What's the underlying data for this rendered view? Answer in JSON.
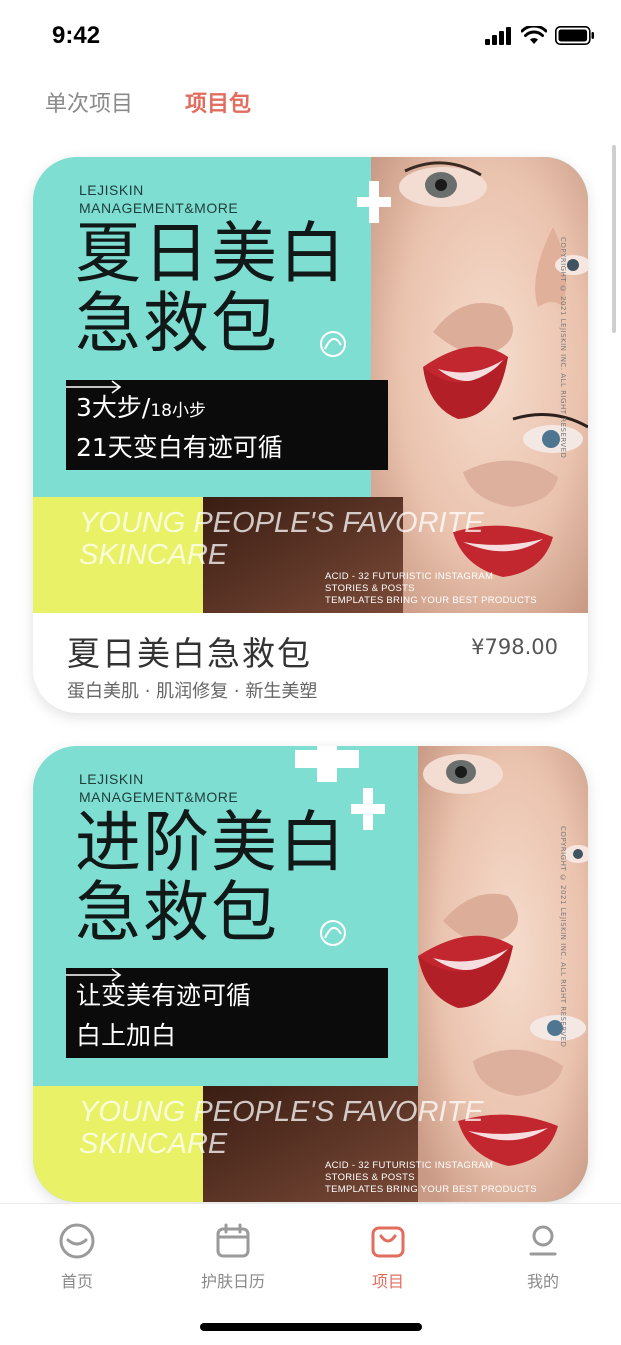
{
  "status": {
    "time": "9:42"
  },
  "tabs": [
    {
      "label": "单次项目",
      "active": false
    },
    {
      "label": "项目包",
      "active": true
    }
  ],
  "accent_color": "#e26d5e",
  "cards": [
    {
      "banner": {
        "brand_line1": "LEJISKIN",
        "brand_line2": "MANAGEMENT&MORE",
        "title_line1": "夏日美白",
        "title_line2": "急救包",
        "box_line1_main": "3大步/",
        "box_line1_small": "18小步",
        "box_line2": "21天变白有迹可循",
        "slogan_line1": "YOUNG PEOPLE'S FAVORITE",
        "slogan_line2": "SKINCARE",
        "small_line1": "ACID - 32 FUTURISTIC INSTAGRAM",
        "small_line2": "STORIES & POSTS",
        "small_line3": "TEMPLATES BRING YOUR BEST PRODUCTS",
        "vertical_text": "COPYRIGHT © 2021 LEJISKIN INC. ALL RIGHT RESERVED"
      },
      "name": "夏日美白急救包",
      "price": "¥798.00",
      "tags": "蛋白美肌 · 肌润修复 · 新生美塑"
    },
    {
      "banner": {
        "brand_line1": "LEJISKIN",
        "brand_line2": "MANAGEMENT&MORE",
        "title_line1": "进阶美白",
        "title_line2": "急救包",
        "box_line1_main": "让变美有迹可循",
        "box_line1_small": "",
        "box_line2": "白上加白",
        "slogan_line1": "YOUNG PEOPLE'S FAVORITE",
        "slogan_line2": "SKINCARE",
        "small_line1": "ACID - 32 FUTURISTIC INSTAGRAM",
        "small_line2": "STORIES & POSTS",
        "small_line3": "TEMPLATES BRING YOUR BEST PRODUCTS",
        "vertical_text": "COPYRIGHT © 2021 LEJISKIN INC. ALL RIGHT RESERVED"
      }
    }
  ],
  "nav": [
    {
      "label": "首页",
      "icon": "smile-face-icon"
    },
    {
      "label": "护肤日历",
      "icon": "calendar-icon"
    },
    {
      "label": "项目",
      "icon": "shopping-bag-icon",
      "active": true
    },
    {
      "label": "我的",
      "icon": "person-icon"
    }
  ]
}
